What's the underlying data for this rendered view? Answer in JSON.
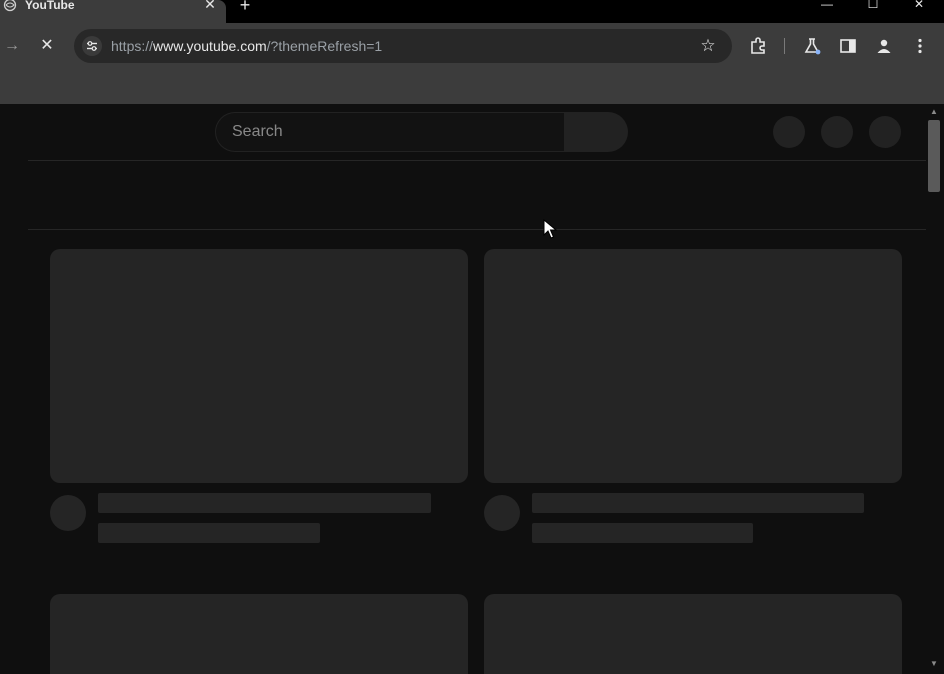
{
  "browser": {
    "tab": {
      "title": "YouTube",
      "favicon": "globe-icon",
      "close_glyph": "✕"
    },
    "new_tab_glyph": "+",
    "window_controls": {
      "minimize": "—",
      "maximize": "☐",
      "close": "✕"
    },
    "toolbar": {
      "back_glyph": "→",
      "stop_glyph": "✕",
      "url_scheme": "https://",
      "url_host": "www.youtube.com",
      "url_path": "/?themeRefresh=1",
      "star_glyph": "☆"
    }
  },
  "page": {
    "search": {
      "placeholder": "Search"
    }
  },
  "scrollbar": {
    "up_glyph": "▲",
    "down_glyph": "▼"
  },
  "colors": {
    "page_bg": "#0f0f0f",
    "skeleton": "#252525",
    "toolbar_bg": "#3c3c3c",
    "titlebar_bg": "#000000"
  }
}
